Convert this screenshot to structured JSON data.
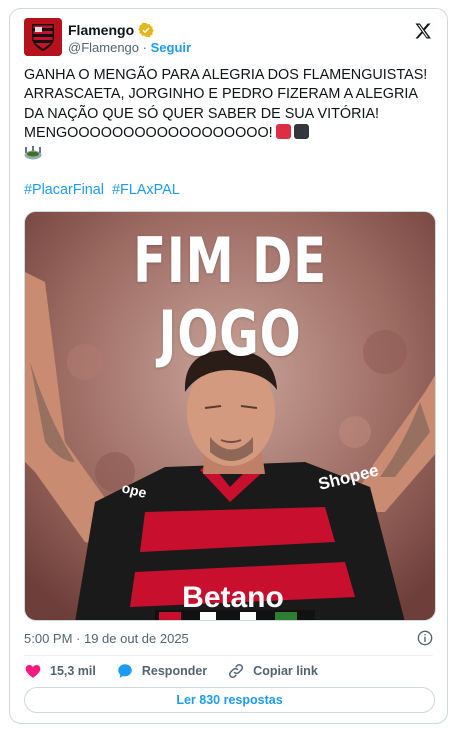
{
  "account": {
    "name": "Flamengo",
    "handle": "@Flamengo",
    "separator": "·",
    "follow_label": "Seguir"
  },
  "tweet": {
    "text": "GANHA O MENGÃO PARA ALEGRIA DOS FLAMENGUISTAS! ARRASCAETA, JORGINHO E PEDRO FIZERAM A ALEGRIA DA NAÇÃO QUE SÓ QUER SABER DE SUA VITÓRIA! MENGOOOOOOOOOOOOOOOOOO!",
    "emoji": [
      "red-square",
      "black-square",
      "stadium"
    ],
    "hashtags": [
      "#PlacarFinal",
      "#FLAxPAL"
    ]
  },
  "media": {
    "headline": "FIM DE JOGO",
    "shirt_sponsor_chest": "Betano",
    "shirt_sponsor_sleeve_right": "Shopee",
    "shirt_sponsor_sleeve_left": "ope"
  },
  "meta": {
    "timestamp": "5:00 PM · 19 de out de 2025"
  },
  "actions": {
    "likes": "15,3 mil",
    "reply_label": "Responder",
    "copy_label": "Copiar link",
    "read_replies": "Ler 830 respostas"
  },
  "colors": {
    "accent": "#1d9bf0",
    "like": "#f91880",
    "brand_red": "#c8102e",
    "verified_gold": "#e2b719"
  }
}
